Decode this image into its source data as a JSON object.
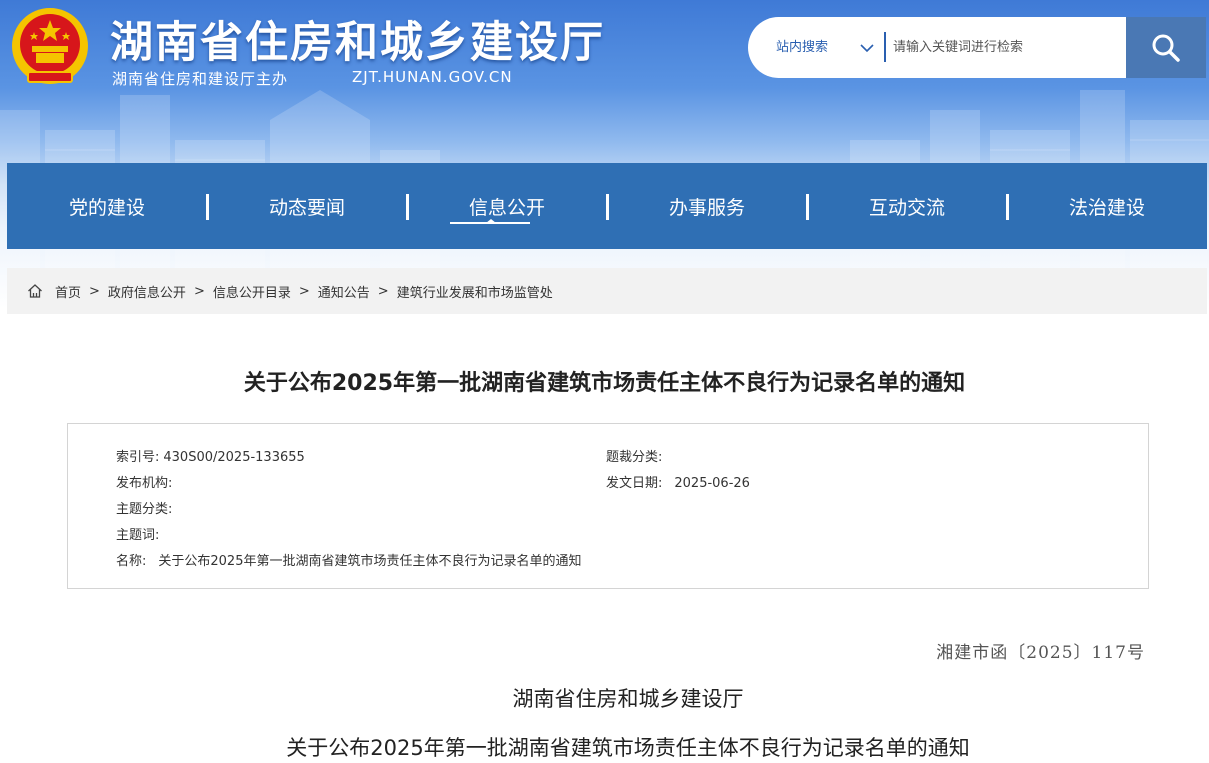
{
  "header": {
    "site_title": "湖南省住房和城乡建设厅",
    "sponsor": "湖南省住房和建设厅主办",
    "domain": "ZJT.HUNAN.GOV.CN"
  },
  "search": {
    "scope_label": "站内搜索",
    "placeholder": "请输入关键词进行检索"
  },
  "nav": {
    "items": [
      {
        "label": "党的建设"
      },
      {
        "label": "动态要闻"
      },
      {
        "label": "信息公开"
      },
      {
        "label": "办事服务"
      },
      {
        "label": "互动交流"
      },
      {
        "label": "法治建设"
      }
    ],
    "active_index": 2
  },
  "breadcrumb": {
    "items": [
      "首页",
      "政府信息公开",
      "信息公开目录",
      "通知公告",
      "建筑行业发展和市场监管处"
    ],
    "separator": ">"
  },
  "article": {
    "title": "关于公布2025年第一批湖南省建筑市场责任主体不良行为记录名单的通知",
    "meta": {
      "index_label": "索引号:",
      "index_value": "430S00/2025-133655",
      "genre_label": "题裁分类:",
      "genre_value": "",
      "publisher_label": "发布机构:",
      "publisher_value": "",
      "date_label": "发文日期:",
      "date_value": "2025-06-26",
      "topic_label": "主题分类:",
      "topic_value": "",
      "keywords_label": "主题词:",
      "keywords_value": "",
      "name_label": "名称:",
      "name_value": "关于公布2025年第一批湖南省建筑市场责任主体不良行为记录名单的通知"
    },
    "doc_number": "湘建市函〔2025〕117号",
    "issuer": "湖南省住房和城乡建设厅",
    "body_title": "关于公布2025年第一批湖南省建筑市场责任主体不良行为记录名单的通知"
  },
  "colors": {
    "nav_bg": "#2f6fb4",
    "search_btn": "#4a78b4",
    "emblem_red": "#d7161b",
    "emblem_gold": "#f5c400"
  },
  "icons": {
    "emblem": "national-emblem-icon",
    "search": "search-icon",
    "chevron": "chevron-down-icon",
    "home": "home-icon"
  }
}
